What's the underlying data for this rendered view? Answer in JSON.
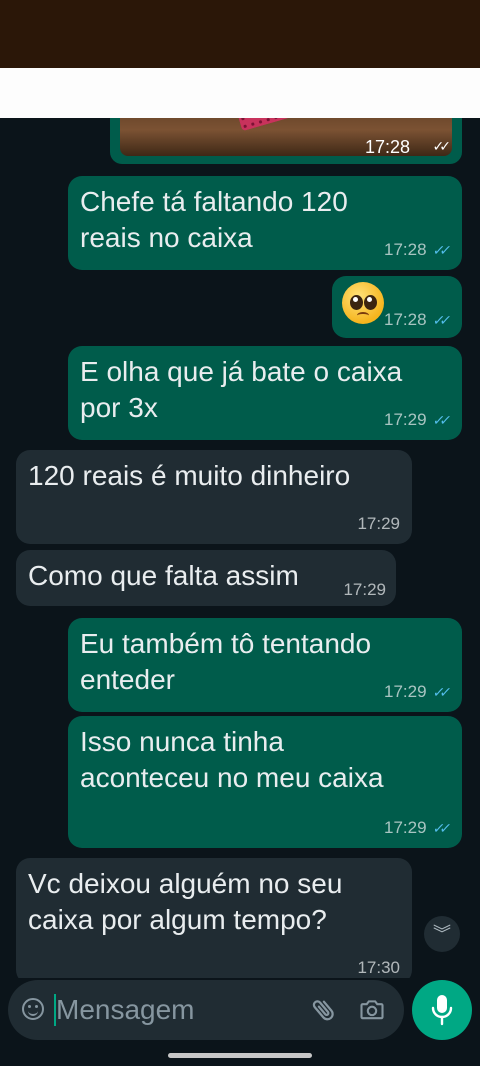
{
  "conversation": {
    "messages": [
      {
        "type": "image",
        "direction": "outgoing",
        "time": "17:28",
        "ticks": "✓✓"
      },
      {
        "direction": "outgoing",
        "text": "Chefe tá faltando 120\nreais no caixa",
        "time": "17:28",
        "ticks": "✓✓"
      },
      {
        "direction": "outgoing",
        "type": "emoji",
        "emoji": "pleading-face",
        "time": "17:28",
        "ticks": "✓✓"
      },
      {
        "direction": "outgoing",
        "text": "E olha que já bate o caixa\npor 3x",
        "time": "17:29",
        "ticks": "✓✓"
      },
      {
        "direction": "incoming",
        "text": "120 reais é muito dinheiro",
        "time": "17:29"
      },
      {
        "direction": "incoming",
        "text": "Como que falta assim",
        "time": "17:29"
      },
      {
        "direction": "outgoing",
        "text": "Eu também tô tentando\nenteder",
        "time": "17:29",
        "ticks": "✓✓"
      },
      {
        "direction": "outgoing",
        "text": "Isso nunca tinha\naconteceu no meu caixa",
        "time": "17:29",
        "ticks": "✓✓"
      },
      {
        "direction": "incoming",
        "text": "Vc deixou alguém no seu\ncaixa por algum tempo?",
        "time": "17:30"
      }
    ]
  },
  "scroll_button": {
    "icon": "double-chevron-down-icon",
    "glyph": "︾"
  },
  "composer": {
    "placeholder": "Mensagem",
    "value": "",
    "icons": [
      "emoji-icon",
      "attach-icon",
      "camera-icon",
      "mic-icon"
    ]
  },
  "colors": {
    "chat_background": "#0b141a",
    "outgoing_bubble": "#005c4b",
    "incoming_bubble": "#202c33",
    "read_ticks": "#53bdeb",
    "accent": "#00a884"
  }
}
